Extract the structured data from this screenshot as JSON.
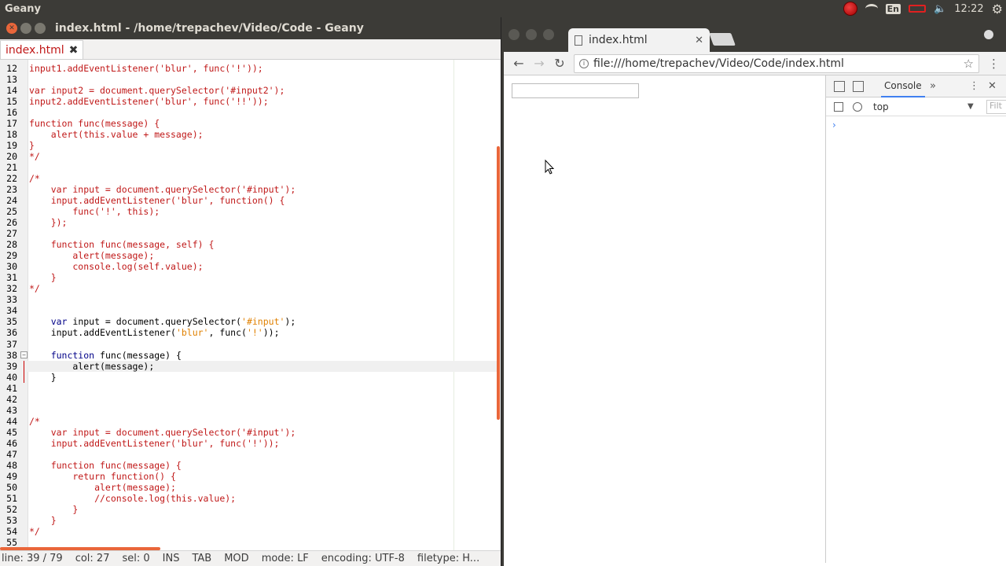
{
  "top_panel": {
    "app_name": "Geany",
    "lang": "En",
    "clock": "12:22"
  },
  "geany": {
    "title": "index.html - /home/trepachev/Video/Code - Geany",
    "tab_label": "index.html",
    "status": {
      "line": "line: 39 / 79",
      "col": "col: 27",
      "sel": "sel: 0",
      "ins": "INS",
      "tab": "TAB",
      "mod": "MOD",
      "mode": "mode: LF",
      "encoding": "encoding: UTF-8",
      "filetype": "filetype: H..."
    },
    "lines": [
      {
        "n": "12",
        "t": "input1.addEventListener('blur', func('!'));",
        "c": false
      },
      {
        "n": "13",
        "t": "",
        "c": false
      },
      {
        "n": "14",
        "t": "var input2 = document.querySelector('#input2');",
        "c": false
      },
      {
        "n": "15",
        "t": "input2.addEventListener('blur', func('!!'));",
        "c": false
      },
      {
        "n": "16",
        "t": "",
        "c": false
      },
      {
        "n": "17",
        "t": "function func(message) {",
        "c": false
      },
      {
        "n": "18",
        "t": "    alert(this.value + message);",
        "c": false
      },
      {
        "n": "19",
        "t": "}",
        "c": false
      },
      {
        "n": "20",
        "t": "*/",
        "c": false
      },
      {
        "n": "21",
        "t": "",
        "c": false
      },
      {
        "n": "22",
        "t": "/*",
        "c": false
      },
      {
        "n": "23",
        "t": "    var input = document.querySelector('#input');",
        "c": false
      },
      {
        "n": "24",
        "t": "    input.addEventListener('blur', function() {",
        "c": false
      },
      {
        "n": "25",
        "t": "        func('!', this);",
        "c": false
      },
      {
        "n": "26",
        "t": "    });",
        "c": false
      },
      {
        "n": "27",
        "t": "",
        "c": false
      },
      {
        "n": "28",
        "t": "    function func(message, self) {",
        "c": false
      },
      {
        "n": "29",
        "t": "        alert(message);",
        "c": false
      },
      {
        "n": "30",
        "t": "        console.log(self.value);",
        "c": false
      },
      {
        "n": "31",
        "t": "    }",
        "c": false
      },
      {
        "n": "32",
        "t": "*/",
        "c": false
      },
      {
        "n": "33",
        "t": "",
        "c": false
      },
      {
        "n": "34",
        "t": "",
        "c": false
      },
      {
        "n": "35",
        "t": "",
        "c": true
      },
      {
        "n": "36",
        "t": "",
        "c": true
      },
      {
        "n": "37",
        "t": "",
        "c": false
      },
      {
        "n": "38",
        "t": "",
        "c": true
      },
      {
        "n": "39",
        "t": "",
        "c": true
      },
      {
        "n": "40",
        "t": "",
        "c": true
      },
      {
        "n": "41",
        "t": "",
        "c": false
      },
      {
        "n": "42",
        "t": "",
        "c": false
      },
      {
        "n": "43",
        "t": "",
        "c": false
      },
      {
        "n": "44",
        "t": "/*",
        "c": false
      },
      {
        "n": "45",
        "t": "    var input = document.querySelector('#input');",
        "c": false
      },
      {
        "n": "46",
        "t": "    input.addEventListener('blur', func('!'));",
        "c": false
      },
      {
        "n": "47",
        "t": "",
        "c": false
      },
      {
        "n": "48",
        "t": "    function func(message) {",
        "c": false
      },
      {
        "n": "49",
        "t": "        return function() {",
        "c": false
      },
      {
        "n": "50",
        "t": "            alert(message);",
        "c": false
      },
      {
        "n": "51",
        "t": "            //console.log(this.value);",
        "c": false
      },
      {
        "n": "52",
        "t": "        }",
        "c": false
      },
      {
        "n": "53",
        "t": "    }",
        "c": false
      },
      {
        "n": "54",
        "t": "*/",
        "c": false
      },
      {
        "n": "55",
        "t": "",
        "c": false
      }
    ],
    "code_segments": {
      "l35": [
        [
          "kw",
          "    var"
        ],
        [
          "plain",
          " input = document.querySelector("
        ],
        [
          "str",
          "'#input'"
        ],
        [
          "plain",
          ");"
        ]
      ],
      "l36": [
        [
          "plain",
          "    input.addEventListener("
        ],
        [
          "str",
          "'blur'"
        ],
        [
          "plain",
          ", func("
        ],
        [
          "str",
          "'!'"
        ],
        [
          "plain",
          "));"
        ]
      ],
      "l38": [
        [
          "kw",
          "    function"
        ],
        [
          "plain",
          " func(message) {"
        ]
      ],
      "l39": [
        [
          "plain",
          "        alert(message);"
        ]
      ],
      "l40": [
        [
          "plain",
          "    }"
        ]
      ]
    }
  },
  "browser": {
    "tab_title": "index.html",
    "url": "file:///home/trepachev/Video/Code/index.html",
    "devtools": {
      "tab_console": "Console",
      "context": "top",
      "filter_placeholder": "Filt",
      "more": "»",
      "kebab": "⋮",
      "close": "✕",
      "prompt": "›"
    }
  }
}
